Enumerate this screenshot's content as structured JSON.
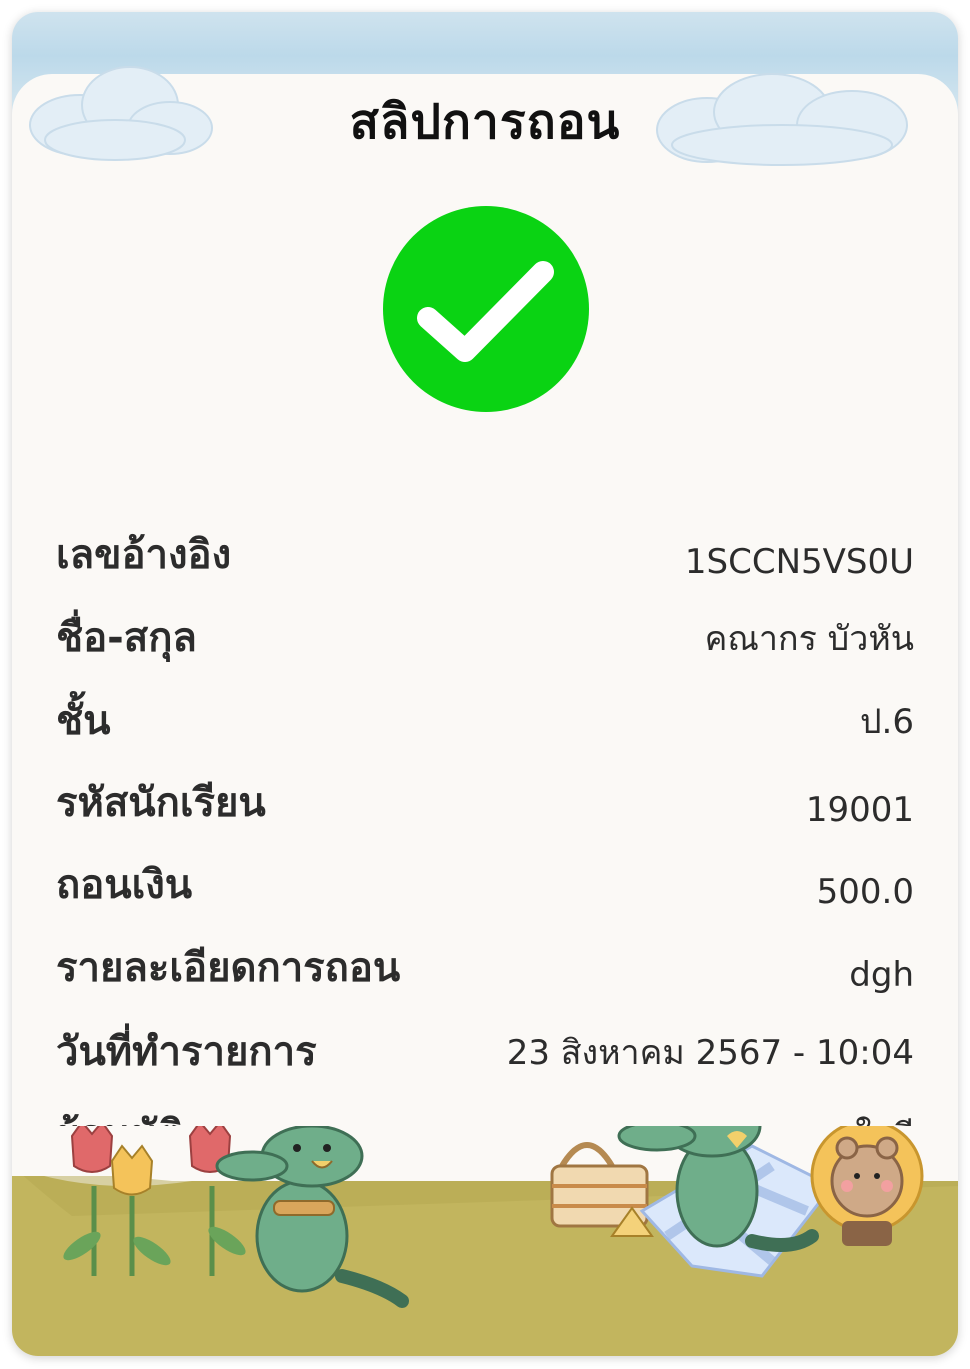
{
  "slip": {
    "title": "สลิปการถอน",
    "status_icon": "check-circle-icon",
    "accent": "#0ad313"
  },
  "details": [
    {
      "label": "เลขอ้างอิง",
      "value": "1SCCN5VS0U"
    },
    {
      "label": "ชื่อ-สกุล",
      "value": "คณากร บัวหัน"
    },
    {
      "label": "ชั้น",
      "value": "ป.6"
    },
    {
      "label": "รหัสนักเรียน",
      "value": "19001"
    },
    {
      "label": "ถอนเงิน",
      "value": "500.0"
    },
    {
      "label": "รายละเอียดการถอน",
      "value": "dgh"
    },
    {
      "label": "วันที่ทำรายการ",
      "value": "23 สิงหาคม 2567 - 10:04"
    },
    {
      "label": "ผู้อนุมัติ",
      "value": "สุดา ใจดี"
    }
  ]
}
